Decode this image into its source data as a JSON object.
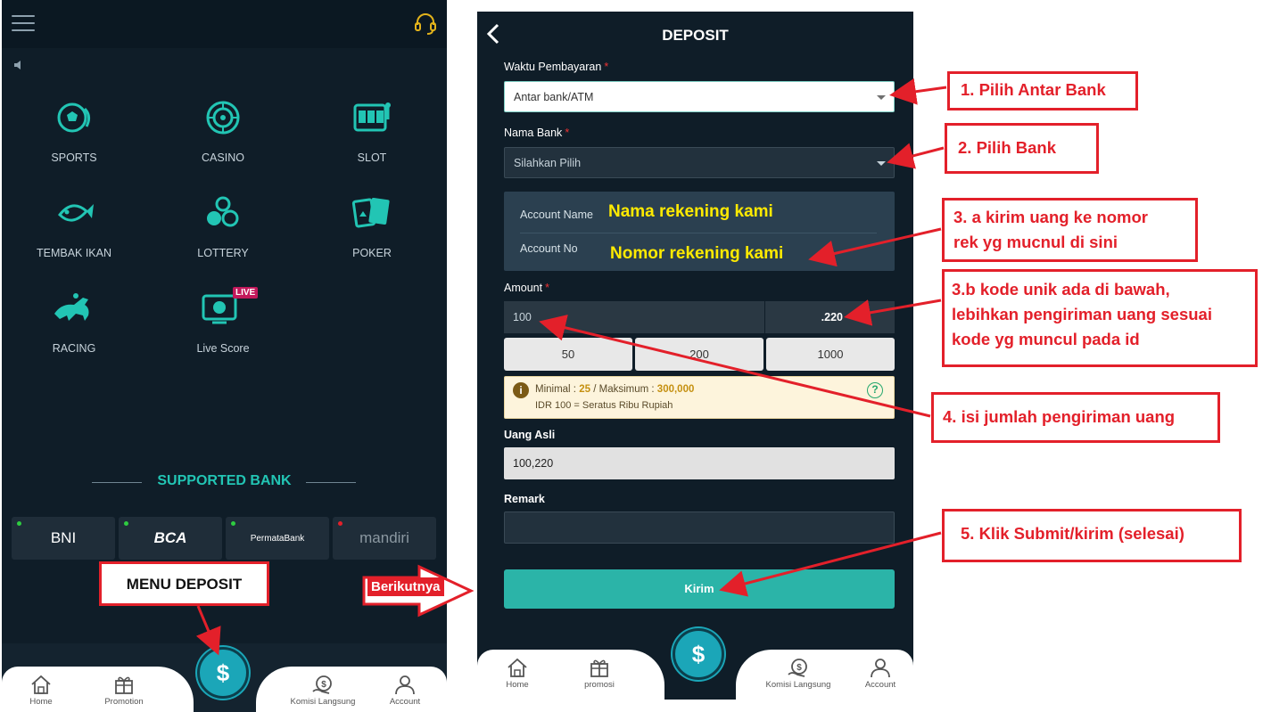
{
  "left_phone": {
    "games": [
      {
        "label": "SPORTS",
        "icon": "soccer-ball-icon"
      },
      {
        "label": "CASINO",
        "icon": "roulette-icon"
      },
      {
        "label": "SLOT",
        "icon": "slot-machine-icon"
      },
      {
        "label": "TEMBAK IKAN",
        "icon": "fish-icon"
      },
      {
        "label": "LOTTERY",
        "icon": "lottery-balls-icon"
      },
      {
        "label": "POKER",
        "icon": "playing-cards-icon"
      },
      {
        "label": "RACING",
        "icon": "horse-racing-icon"
      },
      {
        "label": "Live Score",
        "icon": "live-score-tv-icon",
        "badge": "LIVE"
      }
    ],
    "supported_bank_title": "SUPPORTED BANK",
    "banks": [
      {
        "name": "BNI",
        "status": "#2ecc40"
      },
      {
        "name": "BCA",
        "status": "#2ecc40"
      },
      {
        "name": "PermataBank",
        "status": "#2ecc40"
      },
      {
        "name": "mandiri",
        "status": "#e3202a"
      }
    ],
    "nav": [
      {
        "label": "Home",
        "icon": "home-icon"
      },
      {
        "label": "Promotion",
        "icon": "gift-icon"
      },
      {
        "label": "Komisi Langsung",
        "icon": "commission-icon"
      },
      {
        "label": "Account",
        "icon": "user-icon"
      }
    ],
    "fab_symbol": "$"
  },
  "right_phone": {
    "title": "DEPOSIT",
    "waktu_label": "Waktu Pembayaran",
    "waktu_value": "Antar bank/ATM",
    "bank_label": "Nama Bank",
    "bank_value": "Silahkan Pilih",
    "account_name_label": "Account Name",
    "account_name_value": "Nama rekening kami",
    "account_no_label": "Account No",
    "account_no_value": "Nomor rekening kami",
    "amount_label": "Amount",
    "amount_value": "100",
    "amount_suffix": ".220",
    "presets": [
      "50",
      "200",
      "1000"
    ],
    "info_min_label": "Minimal :",
    "info_min_value": "25",
    "info_sep": "/ Maksimum :",
    "info_max_value": "300,000",
    "info_line2": "IDR 100 = Seratus Ribu Rupiah",
    "uang_asli_label": "Uang Asli",
    "uang_asli_value": "100,220",
    "remark_label": "Remark",
    "submit_label": "Kirim",
    "nav": [
      {
        "label": "Home",
        "icon": "home-icon"
      },
      {
        "label": "promosi",
        "icon": "gift-icon"
      },
      {
        "label": "Komisi Langsung",
        "icon": "commission-icon"
      },
      {
        "label": "Account",
        "icon": "user-icon"
      }
    ],
    "fab_symbol": "$"
  },
  "callouts": {
    "menu": "MENU DEPOSIT",
    "next": "Berikutnya",
    "step1": "1.  Pilih Antar Bank",
    "step2": "2. Pilih Bank",
    "step3a_line1": "3. a kirim uang ke nomor",
    "step3a_line2": "rek yg mucnul di sini",
    "step3b_line1": "3.b kode unik ada di bawah,",
    "step3b_line2": "lebihkan pengiriman uang sesuai",
    "step3b_line3": "kode yg muncul pada id",
    "step4": "4. isi jumlah pengiriman uang",
    "step5": "5. Klik Submit/kirim (selesai)"
  },
  "colors": {
    "accent_teal": "#2bb4a8",
    "annotation_red": "#e3202a",
    "panel_dark": "#0f1d28",
    "highlight_yellow": "#ffea00"
  }
}
